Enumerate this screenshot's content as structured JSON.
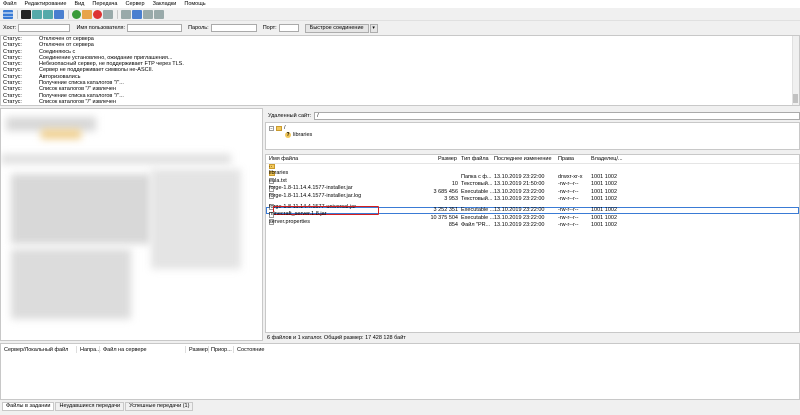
{
  "menu": [
    "Файл",
    "Редактирование",
    "Вид",
    "Передача",
    "Сервер",
    "Закладки",
    "Помощь"
  ],
  "quickconnect": {
    "host_label": "Хост:",
    "user_label": "Имя пользователя:",
    "pass_label": "Пароль:",
    "port_label": "Порт:",
    "button": "Быстрое соединение",
    "dropdown": "▾"
  },
  "log": [
    {
      "k": "Статус:",
      "v": "Отключен от сервера"
    },
    {
      "k": "Статус:",
      "v": "Отключен от сервера"
    },
    {
      "k": "Статус:",
      "v": "Соединяюсь с"
    },
    {
      "k": "Статус:",
      "v": "Соединение установлено, ожидание приглашения..."
    },
    {
      "k": "Статус:",
      "v": "Небезопасный сервер, не поддерживает FTP через TLS."
    },
    {
      "k": "Статус:",
      "v": "Сервер не поддерживает символы не-ASCII."
    },
    {
      "k": "Статус:",
      "v": "Авторизовались"
    },
    {
      "k": "Статус:",
      "v": "Получение списка каталогов \"/\"..."
    },
    {
      "k": "Статус:",
      "v": "Список каталогов \"/\" извлечен"
    },
    {
      "k": "Статус:",
      "v": "Получение списка каталогов \"/\"..."
    },
    {
      "k": "Статус:",
      "v": "Список каталогов \"/\" извлечен"
    }
  ],
  "remote": {
    "label": "Удаленный сайт:",
    "path": "/",
    "tree_root": "/",
    "tree_child": "libraries"
  },
  "columns": [
    "Имя файла",
    "Размер",
    "Тип файла",
    "Последнее изменение",
    "Права",
    "Владелец/..."
  ],
  "files": [
    {
      "name": "..",
      "size": "",
      "type": "",
      "modified": "",
      "perms": "",
      "owner": "",
      "icon": "folder-icon"
    },
    {
      "name": "libraries",
      "size": "",
      "type": "Папка с ф...",
      "modified": "13.10.2019 23:22:00",
      "perms": "drwxr-xr-x",
      "owner": "1001 1002",
      "icon": "folder-icon"
    },
    {
      "name": "eula.txt",
      "size": "10",
      "type": "Текстовый...",
      "modified": "13.10.2019 21:50:00",
      "perms": "-rw-r--r--",
      "owner": "1001 1002",
      "icon": "file-icon"
    },
    {
      "name": "forge-1.8-11.14.4.1577-installer.jar",
      "size": "3 685 456",
      "type": "Executable ...",
      "modified": "13.10.2019 23:22:00",
      "perms": "-rw-r--r--",
      "owner": "1001 1002",
      "icon": "file-icon"
    },
    {
      "name": "forge-1.8-11.14.4.1577-installer.jar.log",
      "size": "3 953",
      "type": "Текстовый...",
      "modified": "13.10.2019 23:22:00",
      "perms": "-rw-r--r--",
      "owner": "1001 1002",
      "icon": "file-icon"
    },
    {
      "name": "forge-1.8-11.14.4.1577-universal.jar",
      "size": "3 252 351",
      "type": "Executable ...",
      "modified": "13.10.2019 23:22:00",
      "perms": "-rw-r--r--",
      "owner": "1001 1002",
      "icon": "file-icon"
    },
    {
      "name": "minecraft_server.1.8.jar",
      "size": "10 375 504",
      "type": "Executable ...",
      "modified": "13.10.2019 23:22:00",
      "perms": "-rw-r--r--",
      "owner": "1001 1002",
      "icon": "file-icon"
    },
    {
      "name": "server.properties",
      "size": "854",
      "type": "Файл \"PR...",
      "modified": "13.10.2019 23:22:00",
      "perms": "-rw-r--r--",
      "owner": "1001 1002",
      "icon": "file-icon"
    }
  ],
  "summary": "6 файлов и 1 каталог. Общий размер: 17 428 128 байт",
  "queue_columns": [
    "Сервер/Локальный файл",
    "Напра...",
    "Файл на сервере",
    "Размер",
    "Приор...",
    "Состояние"
  ],
  "tabs": [
    "Файлы в задании",
    "Неудавшиеся передачи",
    "Успешные передачи (1)"
  ],
  "colors": {
    "highlight": "#d42020",
    "folder": "#f2c85b",
    "accent": "#3a7bd5"
  }
}
